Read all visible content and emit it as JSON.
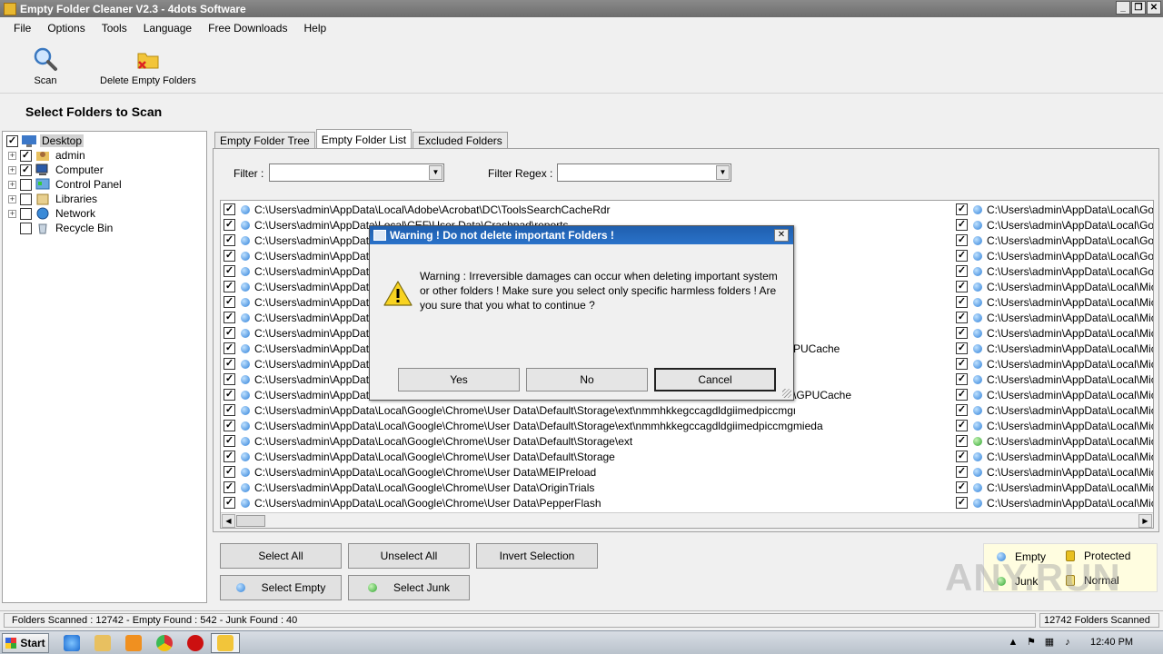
{
  "window": {
    "title": "Empty Folder Cleaner V2.3 - 4dots Software"
  },
  "menu": [
    "File",
    "Options",
    "Tools",
    "Language",
    "Free Downloads",
    "Help"
  ],
  "toolbar": {
    "scan": "Scan",
    "delete": "Delete Empty Folders"
  },
  "section_title": "Select Folders to Scan",
  "tree": [
    {
      "label": "Desktop",
      "checked": true,
      "expander": false
    },
    {
      "label": "admin",
      "checked": true,
      "expander": true
    },
    {
      "label": "Computer",
      "checked": true,
      "expander": true
    },
    {
      "label": "Control Panel",
      "checked": false,
      "expander": true
    },
    {
      "label": "Libraries",
      "checked": false,
      "expander": true
    },
    {
      "label": "Network",
      "checked": false,
      "expander": true
    },
    {
      "label": "Recycle Bin",
      "checked": false,
      "expander": false
    }
  ],
  "tabs": [
    "Empty Folder Tree",
    "Empty Folder List",
    "Excluded Folders"
  ],
  "filter": {
    "label": "Filter :",
    "regex_label": "Filter Regex :"
  },
  "list_left": [
    {
      "path": "C:\\Users\\admin\\AppData\\Local\\Adobe\\Acrobat\\DC\\ToolsSearchCacheRdr",
      "type": "empty"
    },
    {
      "path": "C:\\Users\\admin\\AppData\\Local\\CEF\\User Data\\Crashpad\\reports",
      "type": "empty"
    },
    {
      "path": "C:\\Users\\admin\\AppData\\",
      "type": "empty"
    },
    {
      "path": "C:\\Users\\admin\\AppData\\",
      "type": "empty"
    },
    {
      "path": "C:\\Users\\admin\\AppData\\",
      "type": "empty"
    },
    {
      "path": "C:\\Users\\admin\\AppData\\",
      "type": "empty"
    },
    {
      "path": "C:\\Users\\admin\\AppData\\",
      "type": "empty"
    },
    {
      "path": "C:\\Users\\admin\\AppData\\",
      "type": "empty"
    },
    {
      "path": "C:\\Users\\admin\\AppData\\",
      "type": "empty"
    },
    {
      "path": "C:\\Users\\admin\\AppData\\",
      "type": "empty"
    },
    {
      "path": "C:\\Users\\admin\\AppData\\",
      "type": "empty"
    },
    {
      "path": "C:\\Users\\admin\\AppData\\",
      "type": "empty"
    },
    {
      "path": "C:\\Users\\admin\\AppData\\",
      "type": "empty"
    },
    {
      "path": "C:\\Users\\admin\\AppData\\Local\\Google\\Chrome\\User Data\\Default\\Storage\\ext\\nmmhkkegccagdldgiimedpiccmgmieda\\def",
      "type": "empty"
    },
    {
      "path": "C:\\Users\\admin\\AppData\\Local\\Google\\Chrome\\User Data\\Default\\Storage\\ext\\nmmhkkegccagdldgiimedpiccmgmieda",
      "type": "empty"
    },
    {
      "path": "C:\\Users\\admin\\AppData\\Local\\Google\\Chrome\\User Data\\Default\\Storage\\ext",
      "type": "empty"
    },
    {
      "path": "C:\\Users\\admin\\AppData\\Local\\Google\\Chrome\\User Data\\Default\\Storage",
      "type": "empty"
    },
    {
      "path": "C:\\Users\\admin\\AppData\\Local\\Google\\Chrome\\User Data\\MEIPreload",
      "type": "empty"
    },
    {
      "path": "C:\\Users\\admin\\AppData\\Local\\Google\\Chrome\\User Data\\OriginTrials",
      "type": "empty"
    },
    {
      "path": "C:\\Users\\admin\\AppData\\Local\\Google\\Chrome\\User Data\\PepperFlash",
      "type": "empty"
    }
  ],
  "list_mid_fragments": {
    "row9": "PUCache",
    "row13": "\\GPUCache"
  },
  "list_right": [
    {
      "path": "C:\\Users\\admin\\AppData\\Local\\Goog",
      "type": "empty"
    },
    {
      "path": "C:\\Users\\admin\\AppData\\Local\\Goog",
      "type": "empty"
    },
    {
      "path": "C:\\Users\\admin\\AppData\\Local\\Goog",
      "type": "empty"
    },
    {
      "path": "C:\\Users\\admin\\AppData\\Local\\Goog",
      "type": "empty"
    },
    {
      "path": "C:\\Users\\admin\\AppData\\Local\\Goog",
      "type": "empty"
    },
    {
      "path": "C:\\Users\\admin\\AppData\\Local\\Micr",
      "type": "empty"
    },
    {
      "path": "C:\\Users\\admin\\AppData\\Local\\Micr",
      "type": "empty"
    },
    {
      "path": "C:\\Users\\admin\\AppData\\Local\\Micr",
      "type": "empty"
    },
    {
      "path": "C:\\Users\\admin\\AppData\\Local\\Micr",
      "type": "empty"
    },
    {
      "path": "C:\\Users\\admin\\AppData\\Local\\Micr",
      "type": "empty"
    },
    {
      "path": "C:\\Users\\admin\\AppData\\Local\\Micr",
      "type": "empty"
    },
    {
      "path": "C:\\Users\\admin\\AppData\\Local\\Micr",
      "type": "empty"
    },
    {
      "path": "C:\\Users\\admin\\AppData\\Local\\Micr",
      "type": "empty"
    },
    {
      "path": "C:\\Users\\admin\\AppData\\Local\\Micr",
      "type": "empty"
    },
    {
      "path": "C:\\Users\\admin\\AppData\\Local\\Micr",
      "type": "empty"
    },
    {
      "path": "C:\\Users\\admin\\AppData\\Local\\Micr",
      "type": "junk"
    },
    {
      "path": "C:\\Users\\admin\\AppData\\Local\\Micr",
      "type": "empty"
    },
    {
      "path": "C:\\Users\\admin\\AppData\\Local\\Micr",
      "type": "empty"
    },
    {
      "path": "C:\\Users\\admin\\AppData\\Local\\Micr",
      "type": "empty"
    },
    {
      "path": "C:\\Users\\admin\\AppData\\Local\\Micr",
      "type": "empty"
    }
  ],
  "buttons": {
    "select_all": "Select All",
    "unselect_all": "Unselect All",
    "invert": "Invert Selection",
    "select_empty": "Select Empty",
    "select_junk": "Select Junk"
  },
  "legend": {
    "empty": "Empty",
    "protected": "Protected",
    "junk": "Junk",
    "normal": "Normal"
  },
  "watermark": "ANY.RUN",
  "status": {
    "left": "Folders Scanned : 12742 - Empty Found : 542 - Junk Found : 40",
    "right": "12742 Folders Scanned"
  },
  "taskbar": {
    "start": "Start",
    "clock": "12:40 PM"
  },
  "dialog": {
    "title": "Warning ! Do not delete important Folders !",
    "message": "Warning : Irreversible damages can occur when deleting important system or other folders ! Make sure you select only specific harmless folders ! Are you sure that you what to continue ?",
    "yes": "Yes",
    "no": "No",
    "cancel": "Cancel"
  },
  "colors": {
    "dialog_title": "#2a72c9",
    "empty_dot": "#2d7fd8",
    "junk_dot": "#2ea42e"
  }
}
